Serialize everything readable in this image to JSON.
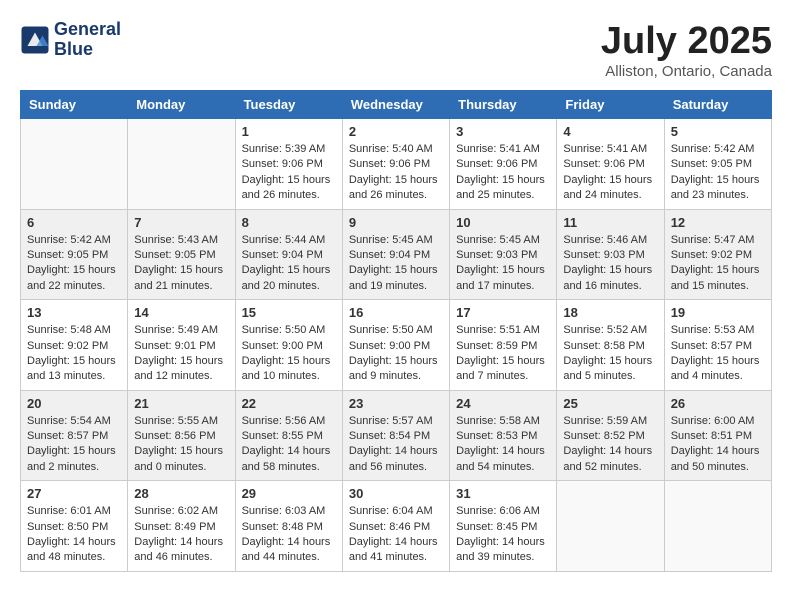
{
  "logo": {
    "line1": "General",
    "line2": "Blue"
  },
  "title": "July 2025",
  "location": "Alliston, Ontario, Canada",
  "headers": [
    "Sunday",
    "Monday",
    "Tuesday",
    "Wednesday",
    "Thursday",
    "Friday",
    "Saturday"
  ],
  "weeks": [
    [
      {
        "day": "",
        "info": ""
      },
      {
        "day": "",
        "info": ""
      },
      {
        "day": "1",
        "info": "Sunrise: 5:39 AM\nSunset: 9:06 PM\nDaylight: 15 hours and 26 minutes."
      },
      {
        "day": "2",
        "info": "Sunrise: 5:40 AM\nSunset: 9:06 PM\nDaylight: 15 hours and 26 minutes."
      },
      {
        "day": "3",
        "info": "Sunrise: 5:41 AM\nSunset: 9:06 PM\nDaylight: 15 hours and 25 minutes."
      },
      {
        "day": "4",
        "info": "Sunrise: 5:41 AM\nSunset: 9:06 PM\nDaylight: 15 hours and 24 minutes."
      },
      {
        "day": "5",
        "info": "Sunrise: 5:42 AM\nSunset: 9:05 PM\nDaylight: 15 hours and 23 minutes."
      }
    ],
    [
      {
        "day": "6",
        "info": "Sunrise: 5:42 AM\nSunset: 9:05 PM\nDaylight: 15 hours and 22 minutes."
      },
      {
        "day": "7",
        "info": "Sunrise: 5:43 AM\nSunset: 9:05 PM\nDaylight: 15 hours and 21 minutes."
      },
      {
        "day": "8",
        "info": "Sunrise: 5:44 AM\nSunset: 9:04 PM\nDaylight: 15 hours and 20 minutes."
      },
      {
        "day": "9",
        "info": "Sunrise: 5:45 AM\nSunset: 9:04 PM\nDaylight: 15 hours and 19 minutes."
      },
      {
        "day": "10",
        "info": "Sunrise: 5:45 AM\nSunset: 9:03 PM\nDaylight: 15 hours and 17 minutes."
      },
      {
        "day": "11",
        "info": "Sunrise: 5:46 AM\nSunset: 9:03 PM\nDaylight: 15 hours and 16 minutes."
      },
      {
        "day": "12",
        "info": "Sunrise: 5:47 AM\nSunset: 9:02 PM\nDaylight: 15 hours and 15 minutes."
      }
    ],
    [
      {
        "day": "13",
        "info": "Sunrise: 5:48 AM\nSunset: 9:02 PM\nDaylight: 15 hours and 13 minutes."
      },
      {
        "day": "14",
        "info": "Sunrise: 5:49 AM\nSunset: 9:01 PM\nDaylight: 15 hours and 12 minutes."
      },
      {
        "day": "15",
        "info": "Sunrise: 5:50 AM\nSunset: 9:00 PM\nDaylight: 15 hours and 10 minutes."
      },
      {
        "day": "16",
        "info": "Sunrise: 5:50 AM\nSunset: 9:00 PM\nDaylight: 15 hours and 9 minutes."
      },
      {
        "day": "17",
        "info": "Sunrise: 5:51 AM\nSunset: 8:59 PM\nDaylight: 15 hours and 7 minutes."
      },
      {
        "day": "18",
        "info": "Sunrise: 5:52 AM\nSunset: 8:58 PM\nDaylight: 15 hours and 5 minutes."
      },
      {
        "day": "19",
        "info": "Sunrise: 5:53 AM\nSunset: 8:57 PM\nDaylight: 15 hours and 4 minutes."
      }
    ],
    [
      {
        "day": "20",
        "info": "Sunrise: 5:54 AM\nSunset: 8:57 PM\nDaylight: 15 hours and 2 minutes."
      },
      {
        "day": "21",
        "info": "Sunrise: 5:55 AM\nSunset: 8:56 PM\nDaylight: 15 hours and 0 minutes."
      },
      {
        "day": "22",
        "info": "Sunrise: 5:56 AM\nSunset: 8:55 PM\nDaylight: 14 hours and 58 minutes."
      },
      {
        "day": "23",
        "info": "Sunrise: 5:57 AM\nSunset: 8:54 PM\nDaylight: 14 hours and 56 minutes."
      },
      {
        "day": "24",
        "info": "Sunrise: 5:58 AM\nSunset: 8:53 PM\nDaylight: 14 hours and 54 minutes."
      },
      {
        "day": "25",
        "info": "Sunrise: 5:59 AM\nSunset: 8:52 PM\nDaylight: 14 hours and 52 minutes."
      },
      {
        "day": "26",
        "info": "Sunrise: 6:00 AM\nSunset: 8:51 PM\nDaylight: 14 hours and 50 minutes."
      }
    ],
    [
      {
        "day": "27",
        "info": "Sunrise: 6:01 AM\nSunset: 8:50 PM\nDaylight: 14 hours and 48 minutes."
      },
      {
        "day": "28",
        "info": "Sunrise: 6:02 AM\nSunset: 8:49 PM\nDaylight: 14 hours and 46 minutes."
      },
      {
        "day": "29",
        "info": "Sunrise: 6:03 AM\nSunset: 8:48 PM\nDaylight: 14 hours and 44 minutes."
      },
      {
        "day": "30",
        "info": "Sunrise: 6:04 AM\nSunset: 8:46 PM\nDaylight: 14 hours and 41 minutes."
      },
      {
        "day": "31",
        "info": "Sunrise: 6:06 AM\nSunset: 8:45 PM\nDaylight: 14 hours and 39 minutes."
      },
      {
        "day": "",
        "info": ""
      },
      {
        "day": "",
        "info": ""
      }
    ]
  ]
}
